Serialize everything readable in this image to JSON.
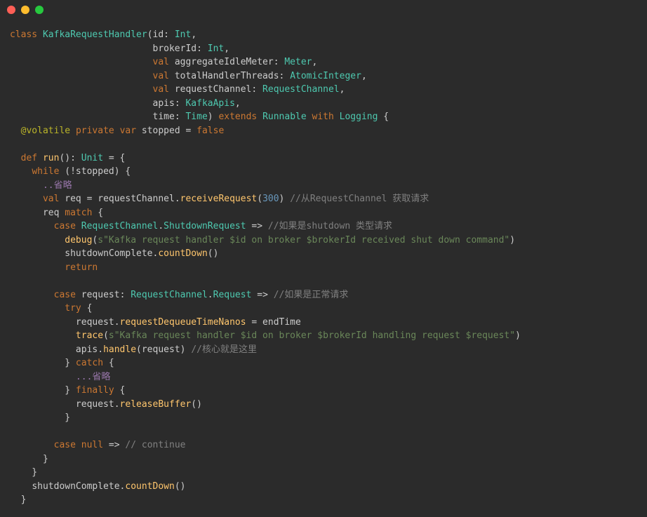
{
  "titlebar": {
    "buttons": [
      "close",
      "minimize",
      "zoom"
    ]
  },
  "code": {
    "line1_class": "class",
    "line1_name": "KafkaRequestHandler",
    "p_id": "id",
    "p_id_t": "Int",
    "p_brokerId": "brokerId",
    "p_brokerId_t": "Int",
    "kw_val": "val",
    "p_aggIdle": "aggregateIdleMeter",
    "p_aggIdle_t": "Meter",
    "p_totalH": "totalHandlerThreads",
    "p_totalH_t": "AtomicInteger",
    "p_reqCh": "requestChannel",
    "p_reqCh_t": "RequestChannel",
    "p_apis": "apis",
    "p_apis_t": "KafkaApis",
    "p_time": "time",
    "p_time_t": "Time",
    "kw_extends": "extends",
    "t_runnable": "Runnable",
    "kw_with": "with",
    "t_logging": "Logging",
    "ann_volatile": "@volatile",
    "kw_private": "private",
    "kw_var": "var",
    "v_stopped": "stopped",
    "b_false": "false",
    "kw_def": "def",
    "fn_run": "run",
    "t_unit": "Unit",
    "kw_while": "while",
    "c_omit1": "..省略",
    "kw_val2": "val",
    "v_req": "req",
    "fn_receive": "receiveRequest",
    "n_300": "300",
    "c_fromRC": "//从RequestChannel 获取请求",
    "kw_match": "match",
    "kw_case": "case",
    "t_RC": "RequestChannel",
    "e_Shutdown": "ShutdownRequest",
    "c_ifShutdown": "//如果是shutdown 类型请求",
    "fn_debug": "debug",
    "s_debug": "s\"Kafka request handler $id on broker $brokerId received shut down command\"",
    "v_shutdownComplete": "shutdownComplete",
    "fn_countDown": "countDown",
    "kw_return": "return",
    "v_request": "request",
    "e_Request": "Request",
    "c_ifNormal": "//如果是正常请求",
    "kw_try": "try",
    "f_reqDeq": "requestDequeueTimeNanos",
    "v_endTime": "endTime",
    "fn_trace": "trace",
    "s_trace": "s\"Kafka request handler $id on broker $brokerId handling request $request\"",
    "fn_handle": "handle",
    "c_core": "//核心就是这里",
    "kw_catch": "catch",
    "c_omit2": "...省略",
    "kw_finally": "finally",
    "fn_release": "releaseBuffer",
    "kw_null": "null",
    "c_continue": "// continue"
  }
}
